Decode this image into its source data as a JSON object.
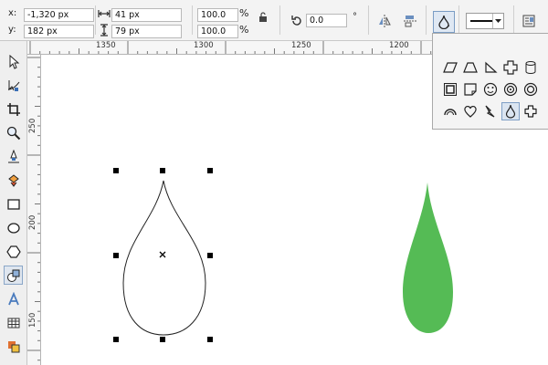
{
  "property_bar": {
    "x_label": "x:",
    "x_value": "-1,320 px",
    "y_label": "y:",
    "y_value": "182 px",
    "width_value": "41 px",
    "height_value": "79 px",
    "scale_x": "100.0",
    "scale_y": "100.0",
    "percent_symbol": "%",
    "rotation_value": "0.0",
    "degree_symbol": "°"
  },
  "rulers": {
    "top": [
      "1350",
      "1300",
      "1250",
      "1200"
    ],
    "left": [
      "250",
      "200",
      "150"
    ]
  },
  "toolbox": {
    "tools": [
      "pick-tool",
      "shape-tool",
      "crop-tool",
      "zoom-tool",
      "freehand-tool",
      "smart-fill-tool",
      "rectangle-tool",
      "ellipse-tool",
      "polygon-tool",
      "basic-shapes-tool",
      "text-tool",
      "table-tool",
      "interactive-fill-tool"
    ],
    "active": "basic-shapes-tool"
  },
  "shape_panel": {
    "shapes": [
      "parallelogram",
      "trapezoid",
      "right-triangle",
      "cross",
      "cylinder",
      "frame",
      "folded-corner",
      "smiley",
      "ring",
      "donut",
      "arc",
      "heart",
      "lightning",
      "teardrop",
      "plus"
    ],
    "selected": "teardrop"
  },
  "canvas": {
    "outline_drop_color": "#222222",
    "filled_drop_color": "#55bb55",
    "handle_color": "#000000"
  }
}
